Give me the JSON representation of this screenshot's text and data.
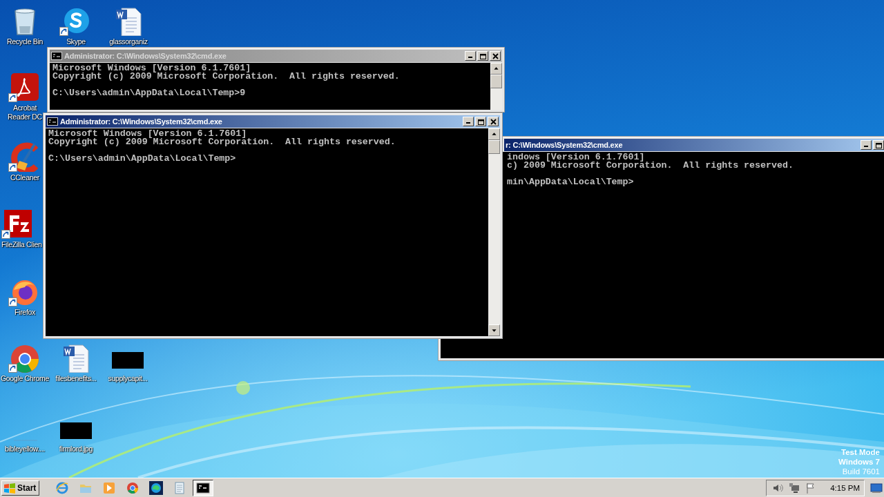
{
  "desktop_icons": [
    {
      "label": "Recycle Bin",
      "kind": "recycle-bin",
      "shortcut": false
    },
    {
      "label": "Skype",
      "kind": "skype",
      "shortcut": true
    },
    {
      "label": "glassorganiz",
      "kind": "word-document",
      "shortcut": false
    },
    {
      "label": "Acrobat Reader DC",
      "kind": "acrobat",
      "shortcut": true
    },
    {
      "label": "CCleaner",
      "kind": "ccleaner",
      "shortcut": true
    },
    {
      "label": "FileZilla Clien",
      "kind": "filezilla",
      "shortcut": true
    },
    {
      "label": "Firefox",
      "kind": "firefox",
      "shortcut": true
    },
    {
      "label": "Google Chrome",
      "kind": "chrome",
      "shortcut": true
    },
    {
      "label": "filesbenefits...",
      "kind": "word-document",
      "shortcut": false
    },
    {
      "label": "supplycapit...",
      "kind": "redacted",
      "shortcut": false
    },
    {
      "label": "bibleyellow....",
      "kind": "blank-file",
      "shortcut": false
    },
    {
      "label": "firmlord.jpg",
      "kind": "redacted",
      "shortcut": false
    }
  ],
  "windows": [
    {
      "title": "Administrator: C:\\Windows\\System32\\cmd.exe",
      "active": false,
      "controls": [
        {
          "kind": "minimize"
        },
        {
          "kind": "maximize"
        },
        {
          "kind": "close"
        }
      ],
      "scrollbar": {
        "down_arrow": false
      },
      "output": [
        [
          "Microsoft Windows [Version 6.1.7601]",
          "Copyright (c) 2009 Microsoft Corporation.  All rights reserved."
        ],
        [
          "C:\\Users\\admin\\AppData\\Local\\Temp>9"
        ]
      ]
    },
    {
      "title": "Administrator: C:\\Windows\\System32\\cmd.exe",
      "active": true,
      "controls": [
        {
          "kind": "minimize"
        },
        {
          "kind": "maximize"
        },
        {
          "kind": "close"
        }
      ],
      "scrollbar": {
        "down_arrow": true
      },
      "output": [
        [
          "Microsoft Windows [Version 6.1.7601]",
          "Copyright (c) 2009 Microsoft Corporation.  All rights reserved."
        ],
        [
          "C:\\Users\\admin\\AppData\\Local\\Temp>"
        ]
      ]
    },
    {
      "title": "r: C:\\Windows\\System32\\cmd.exe",
      "active": true,
      "controls": [
        {
          "kind": "minimize"
        },
        {
          "kind": "maximize"
        }
      ],
      "output": [
        [
          "indows [Version 6.1.7601]",
          "c) 2009 Microsoft Corporation.  All rights reserved."
        ],
        [
          "min\\AppData\\Local\\Temp>"
        ]
      ]
    }
  ],
  "taskbar": {
    "start": "Start",
    "apps": [
      {
        "kind": "internet-explorer",
        "selected": false
      },
      {
        "kind": "folder",
        "selected": false
      },
      {
        "kind": "media-player",
        "selected": false
      },
      {
        "kind": "chrome",
        "selected": false
      },
      {
        "kind": "edge",
        "selected": false
      },
      {
        "kind": "notepad",
        "selected": false
      },
      {
        "kind": "console",
        "selected": true
      }
    ],
    "tray": {
      "time": "4:15 PM"
    }
  },
  "desktop_notice": [
    {
      "text": "Test Mode",
      "bold": true
    },
    {
      "text": "Windows 7",
      "bold": true
    },
    {
      "text": "Build 7601",
      "bold": false
    }
  ]
}
